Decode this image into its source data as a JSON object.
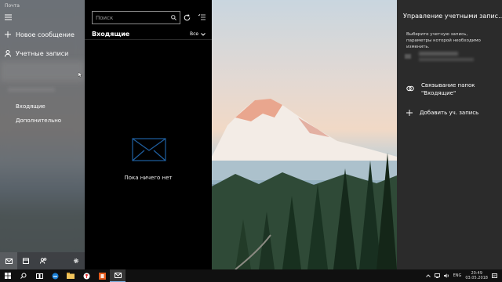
{
  "window": {
    "title": "Почта"
  },
  "nav": {
    "new_message": "Новое сообщение",
    "accounts": "Учетные записи",
    "folders": [
      {
        "label": "Входящие"
      },
      {
        "label": "Дополнительно"
      }
    ]
  },
  "list": {
    "search_placeholder": "Поиск",
    "folder_title": "Входящие",
    "filter": "Все",
    "empty_text": "Пока ничего нет"
  },
  "accounts_panel": {
    "title": "Управление учетными запис...",
    "description": "Выберите учетную запись, параметры которой необходимо изменить.",
    "link_inboxes": "Связывание папок \"Входящие\"",
    "add_account": "Добавить уч. запись"
  },
  "taskbar": {
    "lang": "ENG",
    "time": "20:49",
    "date": "03.05.2018"
  },
  "colors": {
    "accent": "#0078d7",
    "panel": "#2b2b2b"
  }
}
